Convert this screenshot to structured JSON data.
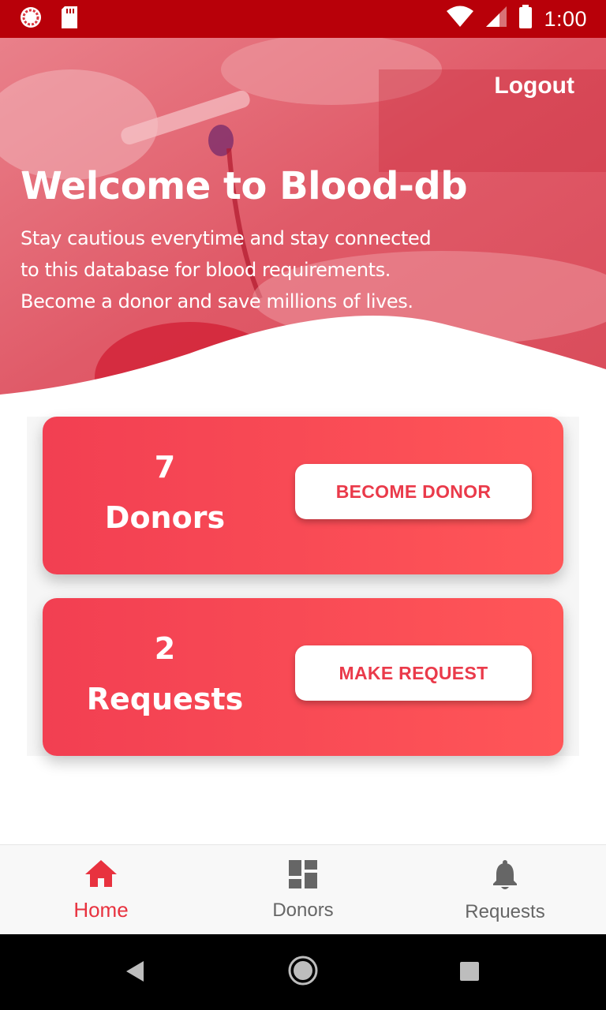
{
  "status_bar": {
    "time": "1:00",
    "icons": [
      "app-notification-icon",
      "sd-card-icon",
      "wifi-icon",
      "cellular-signal-icon",
      "battery-icon"
    ]
  },
  "header": {
    "logout_label": "Logout",
    "title": "Welcome to Blood-db",
    "body_lines": [
      "Stay cautious everytime and stay connected",
      "to this database for blood requirements.",
      "Become a donor and save millions of lives."
    ]
  },
  "cards": {
    "donors": {
      "count": "7",
      "label": "Donors",
      "button_label": "BECOME DONOR"
    },
    "requests": {
      "count": "2",
      "label": "Requests",
      "button_label": "MAKE REQUEST"
    }
  },
  "bottom_nav": {
    "items": [
      {
        "label": "Home",
        "icon": "home-icon",
        "active": true
      },
      {
        "label": "Donors",
        "icon": "dashboard-icon",
        "active": false
      },
      {
        "label": "Requests",
        "icon": "bell-icon",
        "active": false
      }
    ]
  },
  "system_nav": {
    "buttons": [
      "back-icon",
      "home-circle-icon",
      "recents-icon"
    ]
  },
  "colors": {
    "status_bar": "#b80009",
    "accent": "#e8323f",
    "card_gradient_start": "#f23f52",
    "card_gradient_end": "#ff5658",
    "inactive_nav": "#666666"
  }
}
